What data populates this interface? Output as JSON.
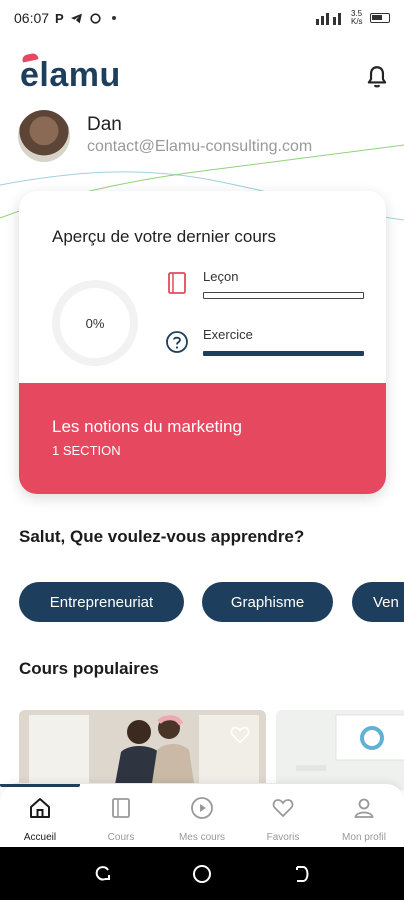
{
  "status_bar": {
    "time": "06:07",
    "left_icons": [
      "P",
      "telegram-icon",
      "refresh-icon"
    ],
    "right_text": "3.5 K/s"
  },
  "header": {
    "logo_text": "elamu"
  },
  "profile": {
    "name": "Dan",
    "email": "contact@Elamu-consulting.com"
  },
  "last_course_card": {
    "title": "Aperçu de votre dernier cours",
    "progress_label": "0%",
    "progress": 0,
    "lesson_label": "Leçon",
    "lesson_progress": 0,
    "exercise_label": "Exercice",
    "exercise_progress": 1,
    "course_name": "Les notions du marketing",
    "sections": "1 SECTION",
    "accent_color": "#e5485f"
  },
  "greeting": "Salut, Que voulez-vous apprendre?",
  "categories": [
    {
      "label": "Entrepreneuriat"
    },
    {
      "label": "Graphisme"
    },
    {
      "label": "Ven"
    }
  ],
  "popular": {
    "title": "Cours populaires"
  },
  "bottom_nav": {
    "items": [
      {
        "label": "Accueil",
        "icon": "home-icon",
        "active": true
      },
      {
        "label": "Cours",
        "icon": "book-icon",
        "active": false
      },
      {
        "label": "Mes cours",
        "icon": "play-icon",
        "active": false
      },
      {
        "label": "Favoris",
        "icon": "heart-icon",
        "active": false
      },
      {
        "label": "Mon profil",
        "icon": "user-icon",
        "active": false
      }
    ]
  },
  "colors": {
    "primary": "#1d3e5c",
    "accent": "#e5485f"
  }
}
